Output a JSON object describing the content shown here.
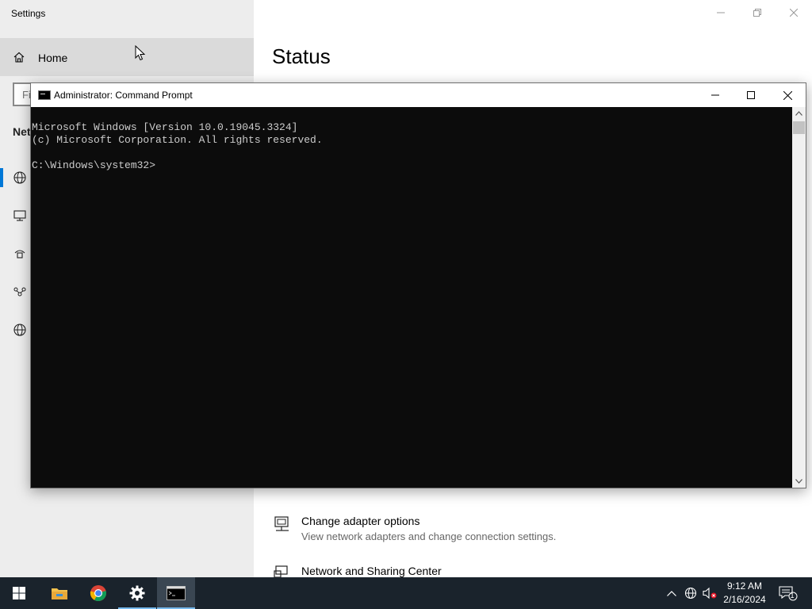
{
  "settings": {
    "window_title": "Settings",
    "home_label": "Home",
    "search_placeholder": "Find a setting",
    "section_heading": "Network & Internet",
    "page_title": "Status",
    "links": [
      {
        "title": "Change adapter options",
        "subtitle": "View network adapters and change connection settings."
      },
      {
        "title": "Network and Sharing Center",
        "subtitle": ""
      }
    ],
    "side_icons": [
      "globe-status-icon",
      "ethernet-icon",
      "dial-up-icon",
      "vpn-icon",
      "proxy-globe-icon"
    ]
  },
  "cmd": {
    "title": "Administrator: Command Prompt",
    "lines": [
      "Microsoft Windows [Version 10.0.19045.3324]",
      "(c) Microsoft Corporation. All rights reserved.",
      "",
      "C:\\Windows\\system32>"
    ]
  },
  "taskbar": {
    "apps": [
      "start-button",
      "file-explorer",
      "chrome",
      "settings",
      "command-prompt"
    ],
    "clock_time": "9:12 AM",
    "clock_date": "2/16/2024",
    "notification_count": "1"
  },
  "colors": {
    "accent": "#0078d7",
    "taskbar": "#1a232c",
    "console_bg": "#0c0c0c",
    "console_text": "#cccccc"
  }
}
